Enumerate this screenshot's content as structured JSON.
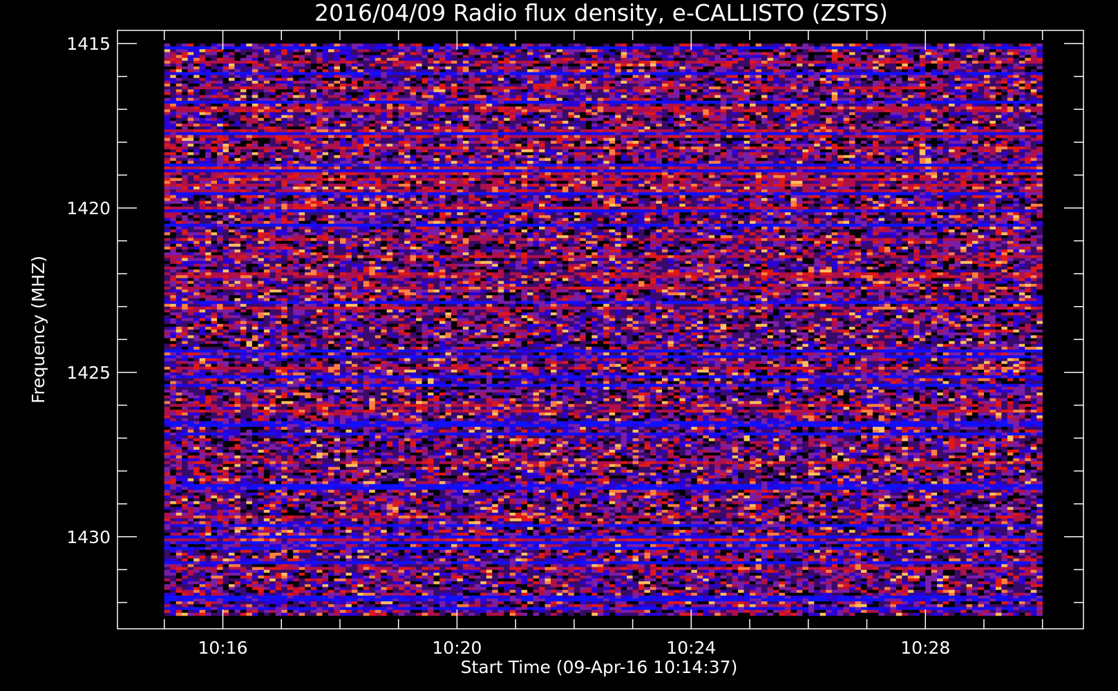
{
  "chart_data": {
    "type": "heatmap",
    "title": "2016/04/09  Radio flux density, e-CALLISTO (ZSTS)",
    "xlabel": "Start Time (09-Apr-16 10:14:37)",
    "ylabel": "Frequency (MHZ)",
    "x_ticks": [
      "10:16",
      "10:20",
      "10:24",
      "10:28"
    ],
    "x_tick_minutes": [
      16,
      20,
      24,
      28
    ],
    "xlim_minutes_after_10h": [
      14.2,
      30.7
    ],
    "data_x_range_minutes_after_10h": [
      15.0,
      30.0
    ],
    "y_ticks": [
      1415,
      1420,
      1425,
      1430
    ],
    "ylim": [
      1414.6,
      1432.8
    ],
    "data_y_range": [
      1415.0,
      1432.4
    ],
    "y_inverted": true,
    "colormap": [
      "#000000",
      "#3a0a6b",
      "#2b00d6",
      "#1010ff",
      "#7a1ea8",
      "#b0104a",
      "#e01818",
      "#ff8040",
      "#ffc060"
    ],
    "background": "#000000",
    "foreground": "#ffffff",
    "grid": false,
    "legend": "none"
  }
}
